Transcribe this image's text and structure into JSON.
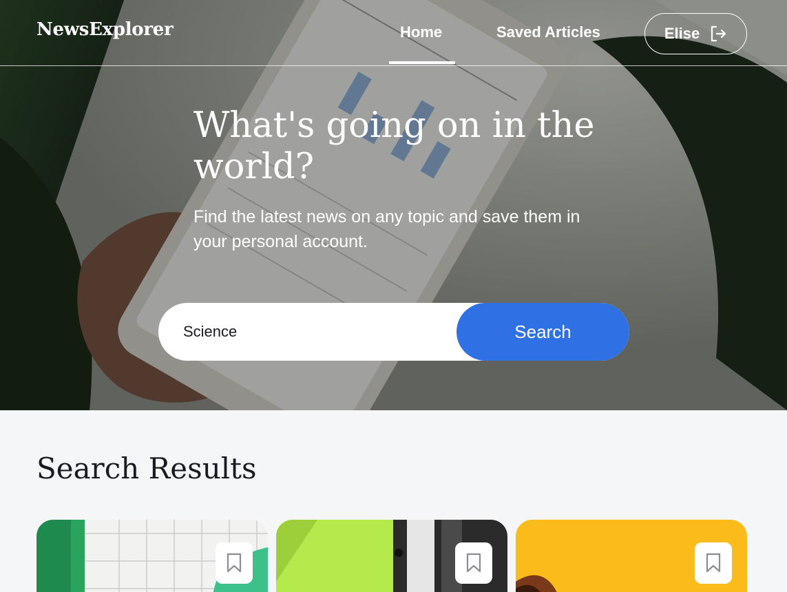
{
  "header": {
    "logo": "NewsExplorer",
    "nav": {
      "home_label": "Home",
      "saved_label": "Saved Articles"
    },
    "user": {
      "name": "Elise",
      "icon": "logout-icon"
    }
  },
  "hero": {
    "title": "What's going on in the world?",
    "subtitle": "Find the latest news on any topic and save them in your personal account.",
    "search": {
      "value": "Science",
      "button_label": "Search"
    }
  },
  "results": {
    "title": "Search Results",
    "cards": [
      {
        "bookmark_icon": "bookmark-icon"
      },
      {
        "bookmark_icon": "bookmark-icon"
      },
      {
        "bookmark_icon": "bookmark-icon"
      }
    ]
  },
  "colors": {
    "accent": "#2f71e5",
    "text_dark": "#1a1b22",
    "results_bg": "#f5f6f7",
    "card3_yellow": "#fbbb1a",
    "card2_lime": "#b4ea4b"
  }
}
